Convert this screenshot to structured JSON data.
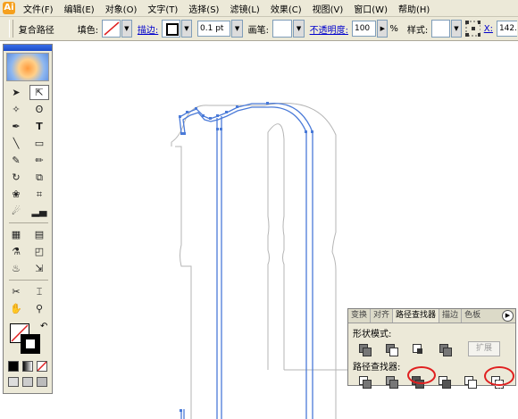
{
  "menubar": {
    "items": [
      "文件(F)",
      "编辑(E)",
      "对象(O)",
      "文字(T)",
      "选择(S)",
      "滤镜(L)",
      "效果(C)",
      "视图(V)",
      "窗口(W)",
      "帮助(H)"
    ]
  },
  "control_bar": {
    "object_type": "复合路径",
    "fill_label": "填色:",
    "stroke_label": "描边:",
    "stroke_weight": "0.1 pt",
    "brush_label": "画笔:",
    "opacity_label": "不透明度:",
    "opacity_value": "100",
    "percent": "%",
    "style_label": "样式:",
    "x_label": "X:",
    "x_value": "142."
  },
  "pathfinder_panel": {
    "tabs": [
      "变换",
      "对齐",
      "路径查找器",
      "描边",
      "色板"
    ],
    "shape_modes_label": "形状模式:",
    "pathfinders_label": "路径查找器:",
    "expand_label": "扩展"
  },
  "colors": {
    "path_blue": "#4a7ad8",
    "outline_gray": "#b0b0b0",
    "annotation_red": "#e02020",
    "ui_bg": "#ece9d8"
  }
}
